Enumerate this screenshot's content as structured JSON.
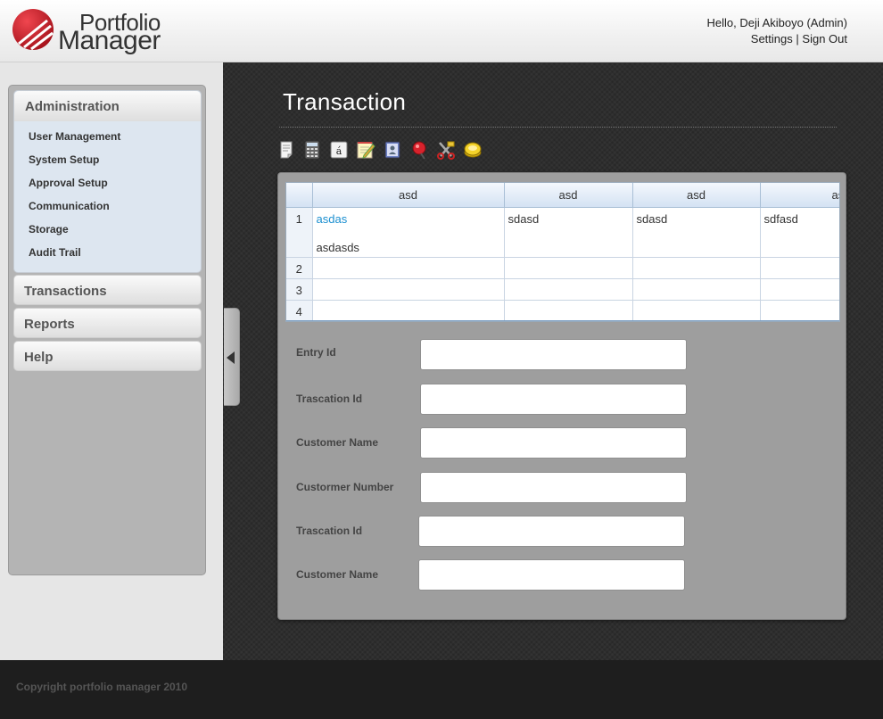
{
  "header": {
    "logo_line1": "Portfolio",
    "logo_line2": "Manager",
    "greeting": "Hello,  Deji Akiboyo (Admin)",
    "settings_link": "Settings",
    "separator": "|",
    "signout_link": "Sign Out"
  },
  "sidebar": {
    "sections": [
      {
        "label": "Administration",
        "items": [
          "User Management",
          "System Setup",
          "Approval Setup",
          "Communication",
          "Storage",
          "Audit Trail"
        ]
      },
      {
        "label": "Transactions"
      },
      {
        "label": "Reports"
      },
      {
        "label": "Help"
      }
    ]
  },
  "page": {
    "title": "Transaction"
  },
  "toolbar": {
    "icons": [
      "notepad-icon",
      "calculator-icon",
      "font-icon",
      "edit-note-icon",
      "address-book-icon",
      "pushpin-icon",
      "cut-icon",
      "coins-icon"
    ]
  },
  "grid": {
    "columns": [
      "asd",
      "asd",
      "asd",
      "as"
    ],
    "rows": [
      {
        "num": "1",
        "cells": [
          "asdas",
          "sdasd",
          "sdasd",
          "sdfasd"
        ],
        "extra": "asdasds"
      },
      {
        "num": "2",
        "cells": [
          "",
          "",
          "",
          ""
        ]
      },
      {
        "num": "3",
        "cells": [
          "",
          "",
          "",
          ""
        ]
      },
      {
        "num": "4",
        "cells": [
          "",
          "",
          "",
          ""
        ]
      }
    ]
  },
  "form": {
    "fields": [
      {
        "label": "Entry Id",
        "value": ""
      },
      {
        "label": "Trascation Id",
        "value": ""
      },
      {
        "label": "Customer Name",
        "value": ""
      },
      {
        "label": "Custormer Number",
        "value": ""
      },
      {
        "label": "Trascation Id",
        "value": ""
      },
      {
        "label": "Customer Name",
        "value": ""
      }
    ]
  },
  "footer": {
    "copyright": "Copyright portfolio manager 2010"
  },
  "colors": {
    "link": "#1b8fd0",
    "logo_red": "#d21f2b",
    "footer_bg": "#1e1e1e"
  }
}
